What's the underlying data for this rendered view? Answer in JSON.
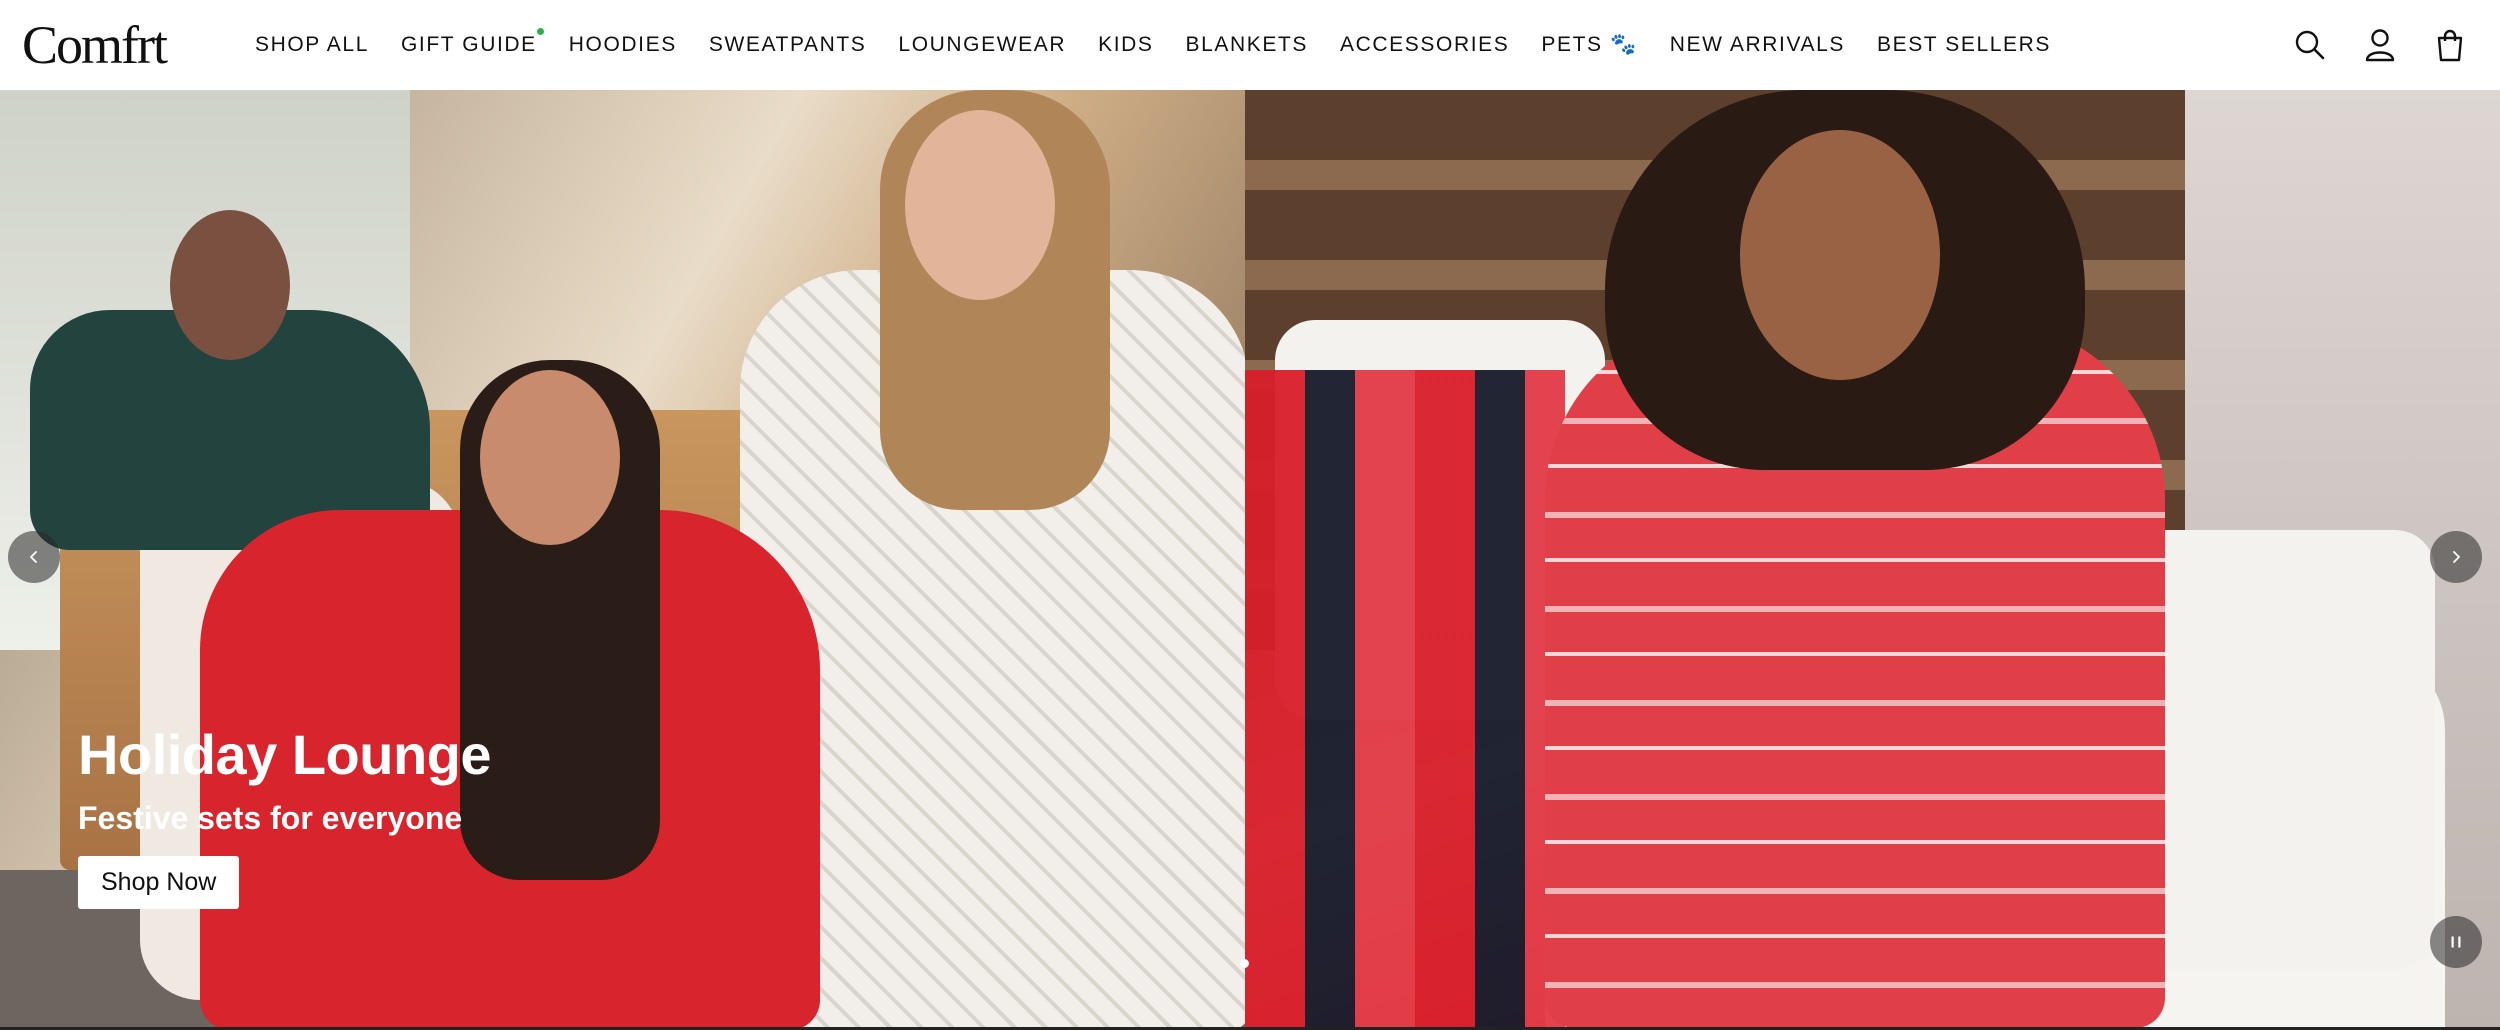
{
  "brand": {
    "logo_text": "Comfrt"
  },
  "nav": {
    "items": [
      {
        "label": "SHOP ALL"
      },
      {
        "label": "GIFT GUIDE",
        "has_indicator": true,
        "indicator_color": "#2bb24c"
      },
      {
        "label": "HOODIES"
      },
      {
        "label": "SWEATPANTS"
      },
      {
        "label": "LOUNGEWEAR"
      },
      {
        "label": "KIDS"
      },
      {
        "label": "BLANKETS"
      },
      {
        "label": "ACCESSORIES"
      },
      {
        "label": "PETS 🐾"
      },
      {
        "label": "NEW ARRIVALS"
      },
      {
        "label": "BEST SELLERS"
      }
    ]
  },
  "header_icons": [
    "search-icon",
    "account-icon",
    "cart-icon"
  ],
  "hero": {
    "title": "Holiday Lounge",
    "subtitle": "Festive sets for everyone",
    "cta_label": "Shop Now",
    "slides_count": 1,
    "active_slide": 1
  },
  "colors": {
    "text": "#111111",
    "hero_text": "#ffffff",
    "control_bg": "#282828"
  }
}
